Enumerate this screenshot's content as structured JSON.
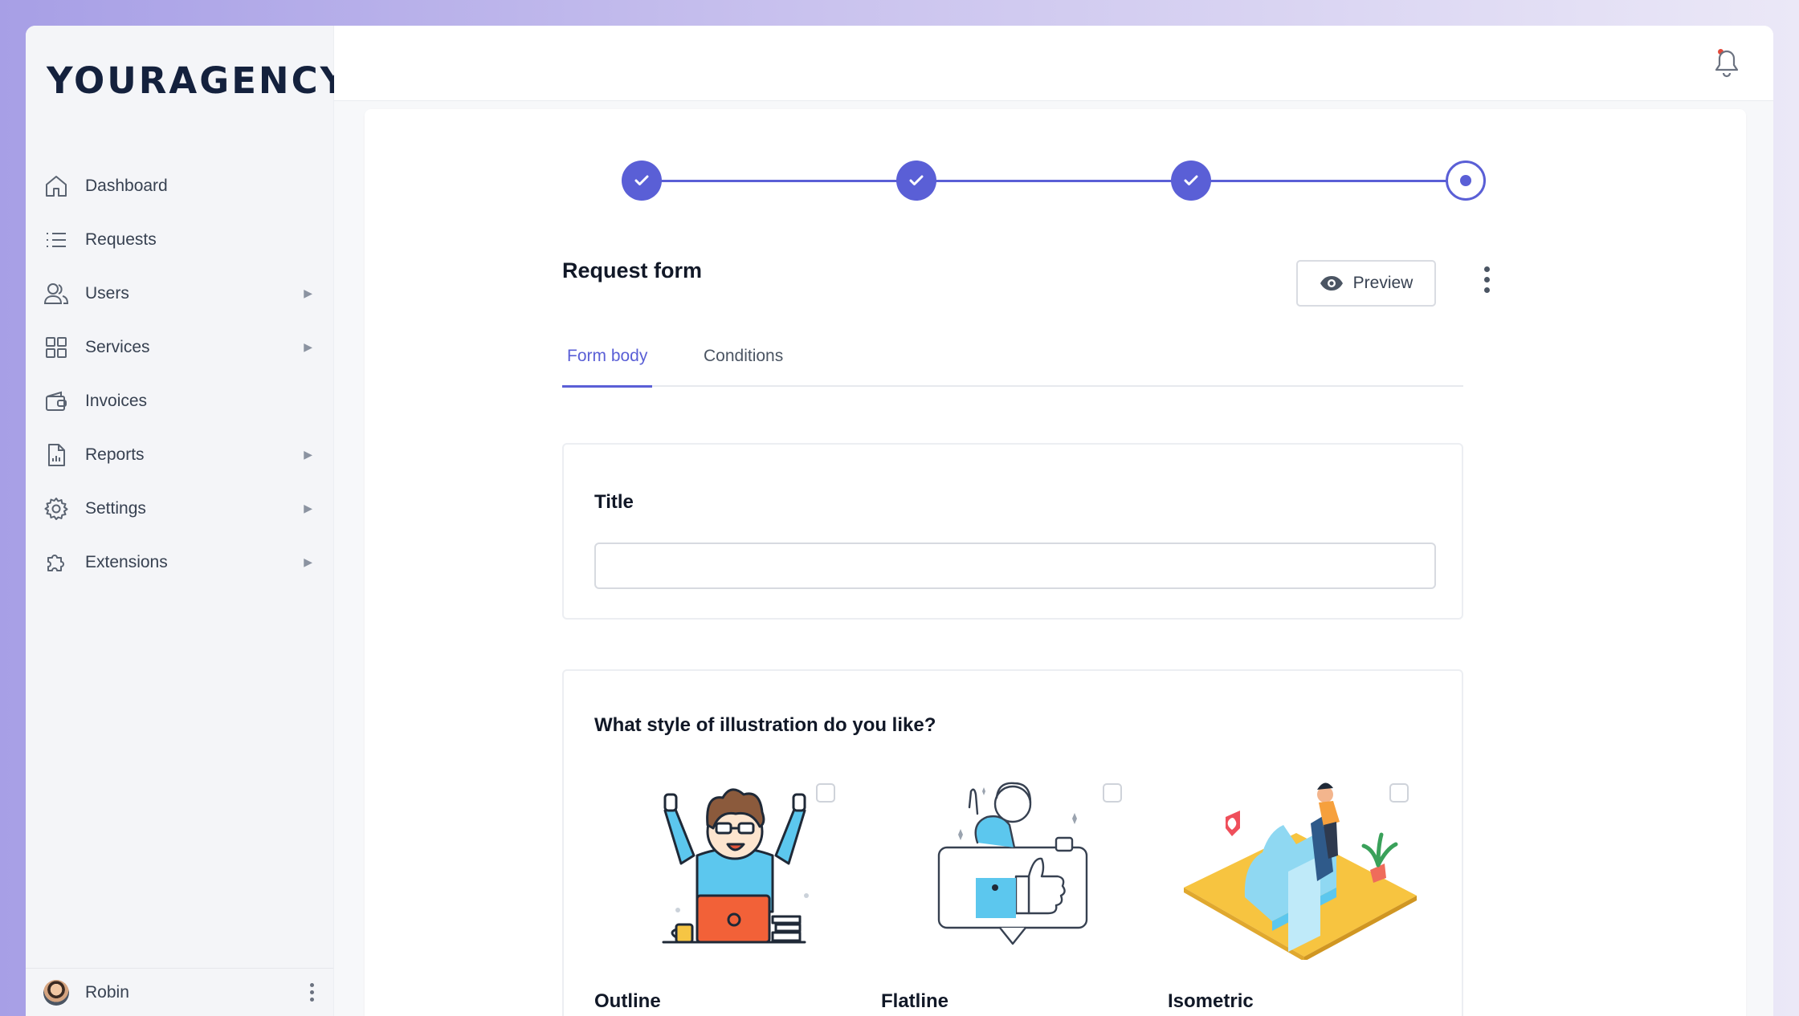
{
  "brand": {
    "logo": "YOURAGENCY"
  },
  "sidebar": {
    "items": [
      {
        "label": "Dashboard",
        "icon": "home-icon",
        "has_submenu": false
      },
      {
        "label": "Requests",
        "icon": "list-icon",
        "has_submenu": false
      },
      {
        "label": "Users",
        "icon": "users-icon",
        "has_submenu": true
      },
      {
        "label": "Services",
        "icon": "grid-icon",
        "has_submenu": true
      },
      {
        "label": "Invoices",
        "icon": "wallet-icon",
        "has_submenu": false
      },
      {
        "label": "Reports",
        "icon": "report-icon",
        "has_submenu": true
      },
      {
        "label": "Settings",
        "icon": "gear-icon",
        "has_submenu": true
      },
      {
        "label": "Extensions",
        "icon": "puzzle-icon",
        "has_submenu": true
      }
    ],
    "caret": "▶"
  },
  "user": {
    "name": "Robin"
  },
  "stepper": {
    "steps_total": 4,
    "completed": 3,
    "current": 4,
    "accent": "#5a5fd6"
  },
  "form": {
    "title": "Request form",
    "preview_label": "Preview",
    "tabs": [
      {
        "label": "Form body",
        "active": true
      },
      {
        "label": "Conditions",
        "active": false
      }
    ],
    "title_field": {
      "label": "Title",
      "value": "",
      "placeholder": ""
    },
    "question": {
      "text": "What style of illustration do you like?",
      "options": [
        {
          "label": "Outline",
          "checked": false
        },
        {
          "label": "Flatline",
          "checked": false
        },
        {
          "label": "Isometric",
          "checked": false
        }
      ]
    }
  },
  "notifications": {
    "has_unread": true,
    "dot_color": "#e24a3b"
  }
}
